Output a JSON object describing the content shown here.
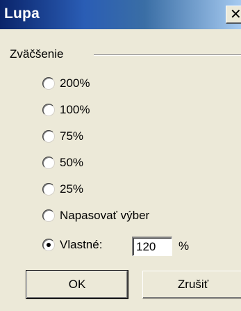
{
  "window": {
    "title": "Lupa",
    "close_glyph": "✕"
  },
  "group": {
    "legend": "Zväčšenie"
  },
  "options": [
    {
      "label": "200%",
      "selected": false
    },
    {
      "label": "100%",
      "selected": false
    },
    {
      "label": "75%",
      "selected": false
    },
    {
      "label": "50%",
      "selected": false
    },
    {
      "label": "25%",
      "selected": false
    },
    {
      "label": "Napasovať výber",
      "selected": false
    },
    {
      "label": "Vlastné:",
      "selected": true
    }
  ],
  "custom": {
    "value": "120",
    "unit": "%"
  },
  "buttons": {
    "ok_label": "OK",
    "cancel_label": "Zrušiť"
  }
}
